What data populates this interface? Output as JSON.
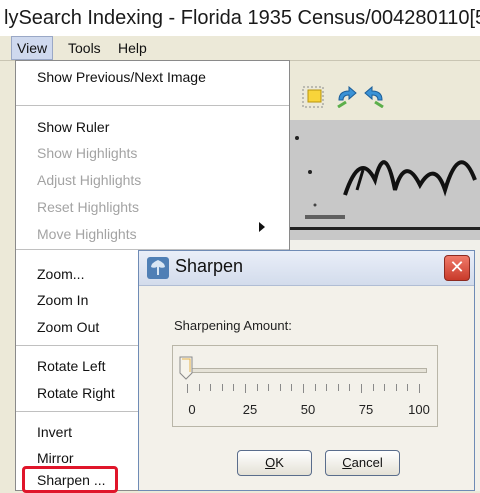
{
  "window": {
    "title": "lySearch Indexing - Florida 1935 Census/004280110[5"
  },
  "menubar": {
    "items": [
      "View",
      "Tools",
      "Help"
    ],
    "active": "View"
  },
  "view_menu": {
    "items": [
      {
        "label": "Show Previous/Next Image",
        "enabled": true
      },
      {
        "label": "Show Ruler",
        "enabled": true
      },
      {
        "label": "Show Highlights",
        "enabled": false
      },
      {
        "label": "Adjust Highlights",
        "enabled": false
      },
      {
        "label": "Reset Highlights",
        "enabled": false
      },
      {
        "label": "Move Highlights",
        "enabled": false,
        "submenu": true
      },
      {
        "label": "Zoom...",
        "enabled": true
      },
      {
        "label": "Zoom In",
        "enabled": true
      },
      {
        "label": "Zoom Out",
        "enabled": true
      },
      {
        "label": "Rotate Left",
        "enabled": true
      },
      {
        "label": "Rotate Right",
        "enabled": true
      },
      {
        "label": "Invert",
        "enabled": true
      },
      {
        "label": "Mirror",
        "enabled": true
      },
      {
        "label": "Sharpen ...",
        "enabled": true,
        "highlighted": true
      }
    ]
  },
  "dialog": {
    "title": "Sharpen",
    "label": "Sharpening Amount:",
    "slider": {
      "value": 0,
      "min": 0,
      "max": 100,
      "tick_labels": [
        "0",
        "25",
        "50",
        "75",
        "100"
      ]
    },
    "ok_label": "OK",
    "cancel_label": "Cancel"
  },
  "colors": {
    "highlight_box": "#e0152a",
    "close_button": "#d2473a"
  }
}
